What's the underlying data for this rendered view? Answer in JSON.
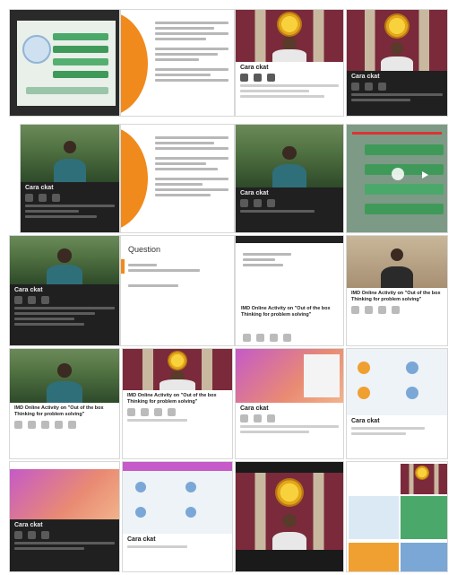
{
  "video": {
    "channel_name": "Cara ckat",
    "tile_title": "IMD Online Activity on \"Out of the box Thinking for problem solving\"",
    "question_heading": "Question"
  },
  "colors": {
    "orange": "#f08a1c",
    "maroon_wall": "#7a2a3a",
    "dark_panel": "#202020",
    "slide_green": "#3f9a5a",
    "slide_purple": "#c55ac8"
  },
  "icons": [
    "like-icon",
    "dislike-icon",
    "share-icon",
    "download-icon",
    "save-icon",
    "play-icon",
    "pause-icon",
    "next-icon"
  ]
}
